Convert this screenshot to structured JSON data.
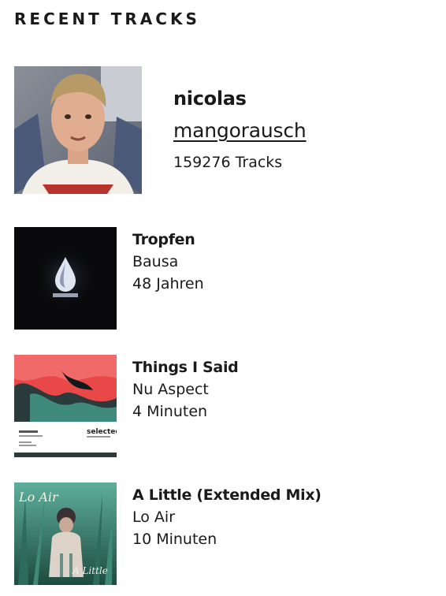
{
  "widget": {
    "title": "RECENT TRACKS"
  },
  "profile": {
    "realname": "nicolas",
    "username": "mangorausch",
    "playcount": "159276 Tracks"
  },
  "tracks": [
    {
      "title": "Tropfen",
      "artist": "Bausa",
      "time": "48 Jahren"
    },
    {
      "title": "Things I Said",
      "artist": "Nu Aspect",
      "time": "4 Minuten"
    },
    {
      "title": "A Little (Extended Mix)",
      "artist": "Lo Air",
      "time": "10 Minuten"
    }
  ],
  "cover_labels": {
    "lo_air": "Lo Air",
    "a_little": "A Little",
    "selected": "selected."
  },
  "colors": {
    "text": "#1a1a1a",
    "background": "#ffffff"
  }
}
